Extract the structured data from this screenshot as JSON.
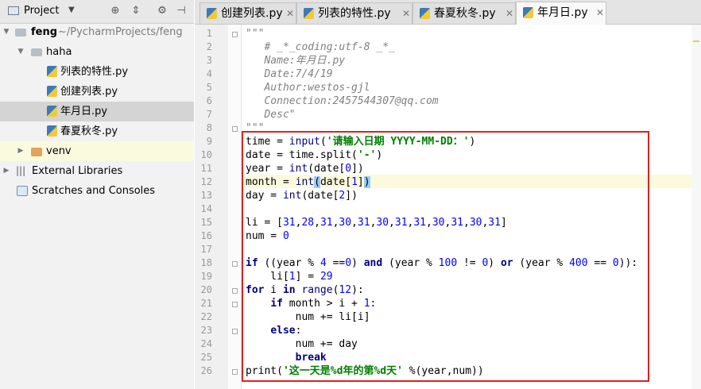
{
  "project_panel": {
    "title": "Project",
    "tree": {
      "root": {
        "name": "feng",
        "path": " ~/PycharmProjects/feng"
      },
      "haha_folder": "haha",
      "files": [
        "列表的特性.py",
        "创建列表.py",
        "年月日.py",
        "春夏秋冬.py"
      ],
      "venv": "venv",
      "external_libraries": "External Libraries",
      "scratches": "Scratches and Consoles"
    }
  },
  "tabs": [
    {
      "label": "创建列表.py"
    },
    {
      "label": "列表的特性.py"
    },
    {
      "label": "春夏秋冬.py"
    },
    {
      "label": "年月日.py"
    }
  ],
  "editor": {
    "line_numbers": [
      "1",
      "2",
      "3",
      "4",
      "5",
      "6",
      "7",
      "8",
      "9",
      "10",
      "11",
      "12",
      "13",
      "14",
      "15",
      "16",
      "17",
      "18",
      "19",
      "20",
      "21",
      "22",
      "23",
      "24",
      "25",
      "26"
    ],
    "docstring": {
      "open": "\"\"\"",
      "coding": "# _*_coding:utf-8 _*_",
      "name": "Name:年月日.py",
      "date": "Date:7/4/19",
      "author": "Author:westos-gjl",
      "connection": "Connection:2457544307@qq.com",
      "desc": "Desc\"",
      "close": "\"\"\""
    },
    "code": {
      "l9_a": "time = ",
      "l9_fn": "input",
      "l9_b": "(",
      "l9_str": "'请输入日期 YYYY-MM-DD：'",
      "l9_c": ")",
      "l10": "date = time.split(",
      "l10_str": "'-'",
      "l10_c": ")",
      "l11_a": "year = ",
      "l11_fn": "int",
      "l11_b": "(date[",
      "l11_n": "0",
      "l11_c": "])",
      "l12_a": "month = ",
      "l12_fn": "int",
      "l12_b": "(",
      "l12_c": "date[",
      "l12_n": "1",
      "l12_d": "]",
      "l12_e": ")",
      "l13_a": "day = ",
      "l13_fn": "int",
      "l13_b": "(date[",
      "l13_n": "2",
      "l13_c": "])",
      "l15_a": "li = [",
      "l15_nums": [
        "31",
        "28",
        "31",
        "30",
        "31",
        "30",
        "31",
        "31",
        "30",
        "31",
        "30",
        "31"
      ],
      "l15_c": "]",
      "l16_a": "num = ",
      "l16_n": "0",
      "l18_if": "if",
      "l18_a": " ((year % ",
      "l18_n1": "4",
      "l18_b": " ==",
      "l18_n2": "0",
      "l18_c": ") ",
      "l18_and": "and",
      "l18_d": " (year % ",
      "l18_n3": "100",
      "l18_e": " != ",
      "l18_n4": "0",
      "l18_f": ") ",
      "l18_or": "or",
      "l18_g": " (year % ",
      "l18_n5": "400",
      "l18_h": " == ",
      "l18_n6": "0",
      "l18_i": ")):",
      "l19_a": "    li[",
      "l19_n1": "1",
      "l19_b": "] = ",
      "l19_n2": "29",
      "l20_for": "for",
      "l20_a": " i ",
      "l20_in": "in",
      "l20_b": " ",
      "l20_fn": "range",
      "l20_c": "(",
      "l20_n": "12",
      "l20_d": "):",
      "l21_pad": "    ",
      "l21_if": "if",
      "l21_a": " month > i + ",
      "l21_n": "1",
      "l21_b": ":",
      "l22": "        num += li[i]",
      "l23_pad": "    ",
      "l23_else": "else",
      "l23_b": ":",
      "l24": "        num += day",
      "l25_pad": "        ",
      "l25_break": "break",
      "l26_a": "print(",
      "l26_str": "'这一天是%d年的第%d天'",
      "l26_b": " %(year,num))"
    }
  }
}
